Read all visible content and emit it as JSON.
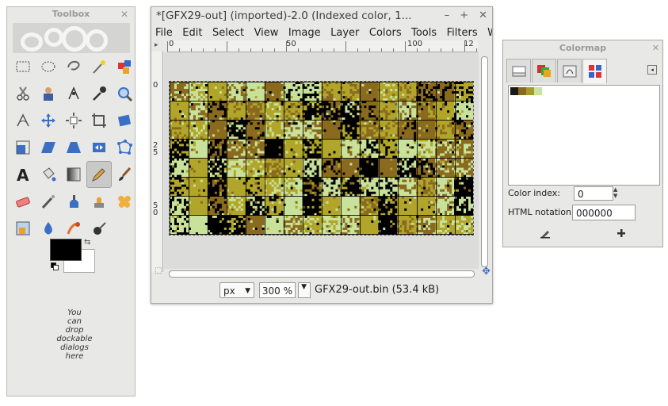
{
  "toolbox": {
    "title": "Toolbox",
    "dock_hint": "You\ncan\ndrop\ndockable\ndialogs\nhere",
    "tools": [
      "rect-select-icon",
      "ellipse-select-icon",
      "lasso-icon",
      "magic-wand-icon",
      "color-select-icon",
      "scissors-icon",
      "foreground-select-icon",
      "paths-icon",
      "color-picker-icon",
      "zoom-icon",
      "measure-icon",
      "move-icon",
      "align-icon",
      "crop-icon",
      "rotate-icon",
      "scale-icon",
      "shear-icon",
      "perspective-icon",
      "flip-icon",
      "cage-icon",
      "text-icon",
      "bucket-fill-icon",
      "blend-icon",
      "pencil-icon",
      "paintbrush-icon",
      "eraser-icon",
      "airbrush-icon",
      "ink-icon",
      "clone-icon",
      "heal-icon",
      "perspective-clone-icon",
      "blur-icon",
      "smudge-icon",
      "dodge-burn-icon"
    ]
  },
  "image_window": {
    "title": "*[GFX29-out] (imported)-2.0 (Indexed color, 1...",
    "menu": [
      "File",
      "Edit",
      "Select",
      "View",
      "Image",
      "Layer",
      "Colors",
      "Tools",
      "Filters",
      "Windo"
    ],
    "ruler_h": [
      "0",
      "50",
      "100",
      "12"
    ],
    "ruler_v": [
      "0",
      "25",
      "50"
    ],
    "unit": "px",
    "zoom": "300 %",
    "status": "GFX29-out.bin (53.4 kB)",
    "palette": [
      "#000000",
      "#8a6a1e",
      "#b1a52a",
      "#c8e29b"
    ]
  },
  "colormap": {
    "title": "Colormap",
    "swatches": [
      "#1a1a1a",
      "#8a6a1e",
      "#a59a2c",
      "#c9e49c"
    ],
    "color_index_label": "Color index:",
    "color_index_value": "0",
    "html_label": "HTML notation:",
    "html_value": "000000"
  }
}
